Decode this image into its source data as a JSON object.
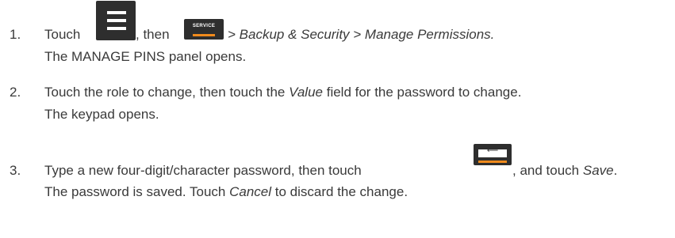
{
  "steps": [
    {
      "number": "1.",
      "touch": "Touch",
      "then": ", then",
      "path": "> Backup & Security > Manage Permissions.",
      "result": "The MANAGE PINS panel opens."
    },
    {
      "number": "2.",
      "line1_a": "Touch the role to change, then touch the",
      "line1_value": "Value",
      "line1_b": "field for the password to change.",
      "result": "The keypad opens."
    },
    {
      "number": "3.",
      "line1_a": "Type a new four-digit/character password, then touch",
      "line1_b": ", and touch",
      "line1_save": "Save",
      "line1_end": ".",
      "result_a": "The password is saved. Touch",
      "result_cancel": "Cancel",
      "result_b": "to discard the change."
    }
  ],
  "icons": {
    "menu": "hamburger-menu-icon",
    "service": {
      "name": "service-icon",
      "label": "SERVICE"
    },
    "enter": {
      "name": "enter-key-icon",
      "glyph": "⟵"
    }
  },
  "colors": {
    "icon_bg": "#2e2e2e",
    "accent": "#f08a1c",
    "text": "#3a3a3a"
  }
}
